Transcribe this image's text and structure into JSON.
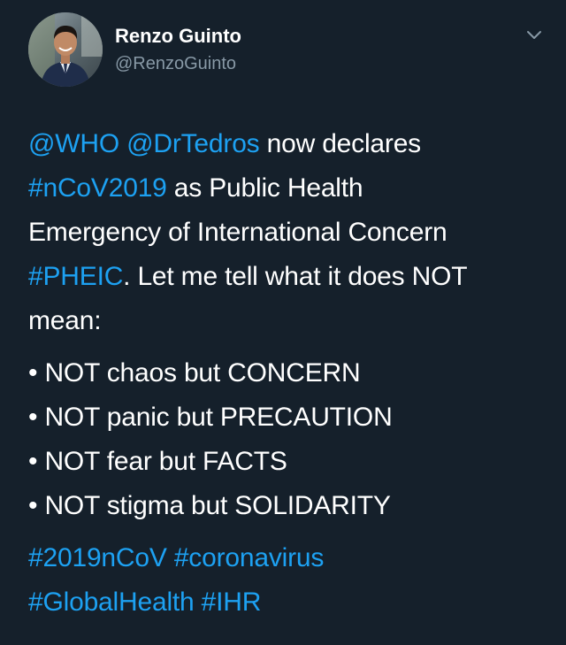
{
  "author": {
    "display_name": "Renzo Guinto",
    "handle": "@RenzoGuinto",
    "avatar_icon": "profile-photo"
  },
  "menu": {
    "icon": "chevron-down-icon"
  },
  "tweet": {
    "mention_1": "@WHO",
    "mention_2": "@DrTedros",
    "text_1": " now declares",
    "hashtag_ncov2019": "#nCoV2019",
    "text_2": " as Public Health",
    "text_3": "Emergency of International Concern",
    "hashtag_pheic": "#PHEIC",
    "text_4": ". Let me tell what it does NOT",
    "text_5": "mean:",
    "bullets": [
      "• NOT chaos but CONCERN",
      "• NOT panic but PRECAUTION",
      "• NOT fear but FACTS",
      "• NOT stigma but SOLIDARITY"
    ],
    "hashtags_line_1": [
      "#2019nCoV",
      "#coronavirus"
    ],
    "hashtags_line_2": [
      "#GlobalHealth",
      "#IHR"
    ]
  },
  "colors": {
    "background": "#15202b",
    "link": "#1da1f2",
    "secondary_text": "#8899a6",
    "primary_text": "#ffffff"
  }
}
